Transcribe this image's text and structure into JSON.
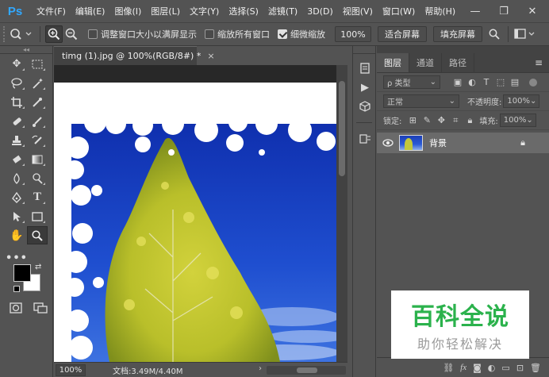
{
  "app": {
    "logo": "Ps"
  },
  "menu": [
    "文件(F)",
    "编辑(E)",
    "图像(I)",
    "图层(L)",
    "文字(Y)",
    "选择(S)",
    "滤镜(T)",
    "3D(D)",
    "视图(V)",
    "窗口(W)",
    "帮助(H)"
  ],
  "window_controls": {
    "minimize": "—",
    "restore": "❐",
    "close": "✕"
  },
  "options": {
    "resize_windows": {
      "label": "调整窗口大小以满屏显示",
      "checked": false
    },
    "zoom_all": {
      "label": "缩放所有窗口",
      "checked": false
    },
    "scrubby_zoom": {
      "label": "细微缩放",
      "checked": true
    },
    "zoom_value": "100%",
    "fit_screen": "适合屏幕",
    "fill_screen": "填充屏幕"
  },
  "document": {
    "tab_title": "timg (1).jpg @ 100%(RGB/8#) *",
    "tab_close": "×",
    "zoom": "100%",
    "doc_info": "文档:3.49M/4.40M"
  },
  "panel": {
    "tabs": [
      "图层",
      "通道",
      "路径"
    ],
    "filter_kind": "ρ 类型",
    "blend_mode": "正常",
    "opacity_label": "不透明度:",
    "opacity_value": "100%",
    "lock_label": "锁定:",
    "fill_label": "填充:",
    "fill_value": "100%",
    "layer_name": "背景"
  },
  "watermark": {
    "main": "百科全说",
    "sub": "助你轻松解决"
  },
  "colors": {
    "foreground": "#000000",
    "background": "#ffffff",
    "ps_blue": "#31a8ff",
    "watermark_green": "#2bb24c",
    "sky_blue": "#1f45c4"
  }
}
